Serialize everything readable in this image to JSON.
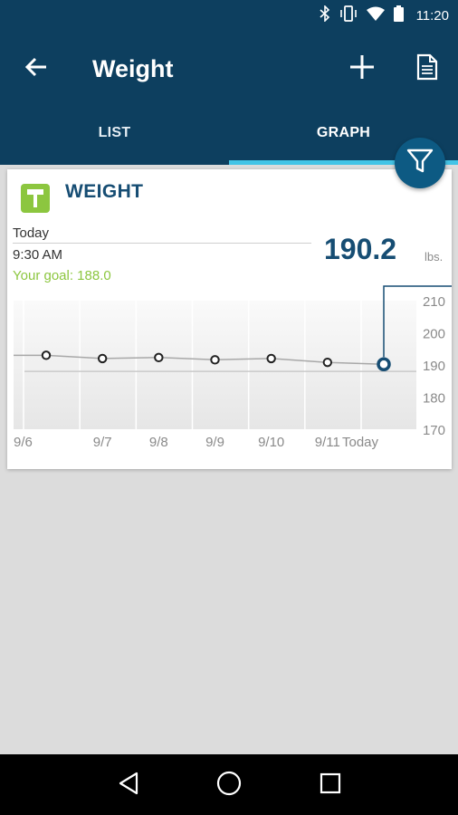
{
  "status_bar": {
    "time": "11:20",
    "icons": [
      "bluetooth-icon",
      "vibrate-icon",
      "wifi-icon",
      "battery-icon"
    ]
  },
  "header": {
    "title": "Weight",
    "back_icon": "arrow-left-icon",
    "add_icon": "plus-icon",
    "report_icon": "document-icon"
  },
  "tabs": [
    {
      "label": "LIST",
      "active": false
    },
    {
      "label": "GRAPH",
      "active": true
    }
  ],
  "filter_icon": "filter-icon",
  "card": {
    "icon": "scale-icon",
    "title": "WEIGHT",
    "date": "Today",
    "time": "9:30 AM",
    "goal": "Your goal: 188.0",
    "value": "190.2",
    "unit": "lbs."
  },
  "chart_data": {
    "type": "line",
    "categories": [
      "9/6",
      "9/7",
      "9/8",
      "9/9",
      "9/10",
      "9/11",
      "Today"
    ],
    "values": [
      193.0,
      192.0,
      192.3,
      191.6,
      192.0,
      190.8,
      190.2
    ],
    "goal": 188.0,
    "yticks": [
      210,
      200,
      190,
      180,
      170
    ],
    "ylim": [
      170,
      210
    ],
    "grid": true,
    "colors": {
      "line": "#a8a8a8",
      "goal_line": "#c9c9c9",
      "marker": "#222222",
      "highlight": "#164d73"
    }
  },
  "nav": {
    "back_icon": "triangle-back-icon",
    "home_icon": "circle-home-icon",
    "recents_icon": "square-recents-icon"
  },
  "colors": {
    "primary": "#0d3f5f",
    "accent": "#43c4e6",
    "goal": "#8cc63f",
    "value": "#164d73"
  }
}
